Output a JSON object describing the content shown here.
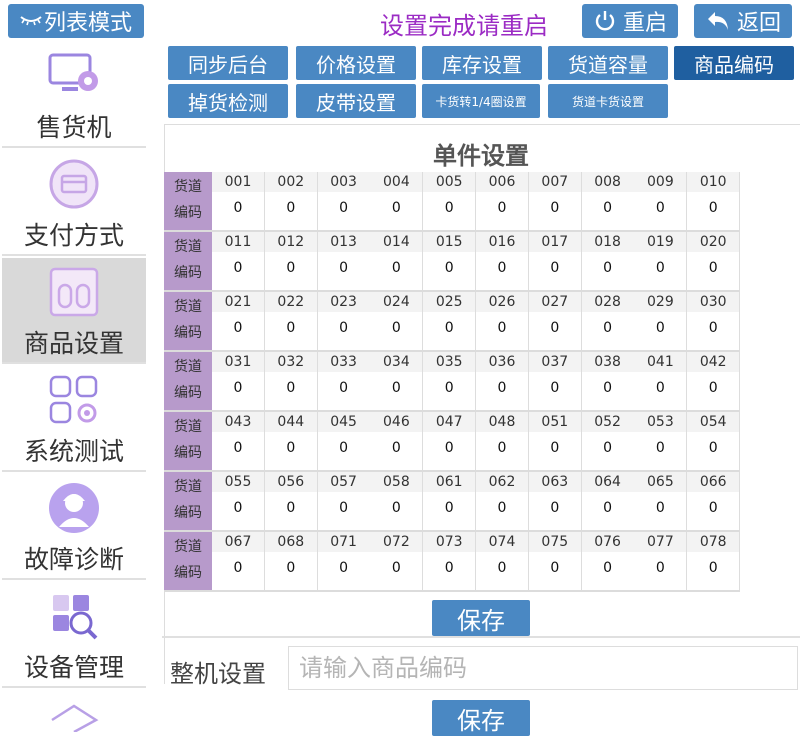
{
  "topbar": {
    "list_mode_label": "列表模式",
    "hint_text": "设置完成请重启",
    "restart_label": "重启",
    "back_label": "返回"
  },
  "sidebar": {
    "items": [
      {
        "label": "售货机",
        "icon": "vending-machine-icon"
      },
      {
        "label": "支付方式",
        "icon": "card-payment-icon"
      },
      {
        "label": "商品设置",
        "icon": "product-settings-icon"
      },
      {
        "label": "系统测试",
        "icon": "apps-gear-icon"
      },
      {
        "label": "故障诊断",
        "icon": "technician-icon"
      },
      {
        "label": "设备管理",
        "icon": "device-search-icon"
      },
      {
        "label": "",
        "icon": "chevron-icon"
      }
    ],
    "active_index": 2
  },
  "tabs": [
    {
      "label": "同步后台"
    },
    {
      "label": "价格设置"
    },
    {
      "label": "库存设置"
    },
    {
      "label": "货道容量"
    },
    {
      "label": "商品编码"
    },
    {
      "label": "掉货检测"
    },
    {
      "label": "皮带设置"
    },
    {
      "label": "卡货转1/4圈设置"
    },
    {
      "label": "货道卡货设置"
    }
  ],
  "active_tab": 4,
  "section_title": "单件设置",
  "row_labels": {
    "lane": "货道",
    "code": "编码"
  },
  "rows": [
    {
      "lanes": [
        "001",
        "002",
        "003",
        "004",
        "005",
        "006",
        "007",
        "008",
        "009",
        "010"
      ],
      "codes": [
        "0",
        "0",
        "0",
        "0",
        "0",
        "0",
        "0",
        "0",
        "0",
        "0"
      ]
    },
    {
      "lanes": [
        "011",
        "012",
        "013",
        "014",
        "015",
        "016",
        "017",
        "018",
        "019",
        "020"
      ],
      "codes": [
        "0",
        "0",
        "0",
        "0",
        "0",
        "0",
        "0",
        "0",
        "0",
        "0"
      ]
    },
    {
      "lanes": [
        "021",
        "022",
        "023",
        "024",
        "025",
        "026",
        "027",
        "028",
        "029",
        "030"
      ],
      "codes": [
        "0",
        "0",
        "0",
        "0",
        "0",
        "0",
        "0",
        "0",
        "0",
        "0"
      ]
    },
    {
      "lanes": [
        "031",
        "032",
        "033",
        "034",
        "035",
        "036",
        "037",
        "038",
        "041",
        "042"
      ],
      "codes": [
        "0",
        "0",
        "0",
        "0",
        "0",
        "0",
        "0",
        "0",
        "0",
        "0"
      ]
    },
    {
      "lanes": [
        "043",
        "044",
        "045",
        "046",
        "047",
        "048",
        "051",
        "052",
        "053",
        "054"
      ],
      "codes": [
        "0",
        "0",
        "0",
        "0",
        "0",
        "0",
        "0",
        "0",
        "0",
        "0"
      ]
    },
    {
      "lanes": [
        "055",
        "056",
        "057",
        "058",
        "061",
        "062",
        "063",
        "064",
        "065",
        "066"
      ],
      "codes": [
        "0",
        "0",
        "0",
        "0",
        "0",
        "0",
        "0",
        "0",
        "0",
        "0"
      ]
    },
    {
      "lanes": [
        "067",
        "068",
        "071",
        "072",
        "073",
        "074",
        "075",
        "076",
        "077",
        "078"
      ],
      "codes": [
        "0",
        "0",
        "0",
        "0",
        "0",
        "0",
        "0",
        "0",
        "0",
        "0"
      ]
    }
  ],
  "save_label": "保存",
  "whole_machine": {
    "label": "整机设置",
    "placeholder": "请输入商品编码",
    "save_label": "保存"
  },
  "colors": {
    "button_blue": "#4a88c3",
    "active_tab": "#1f5fa0",
    "hint_purple": "#9b2bc4",
    "row_label_purple": "#b79acb",
    "sidebar_active": "#d9d9d9"
  }
}
